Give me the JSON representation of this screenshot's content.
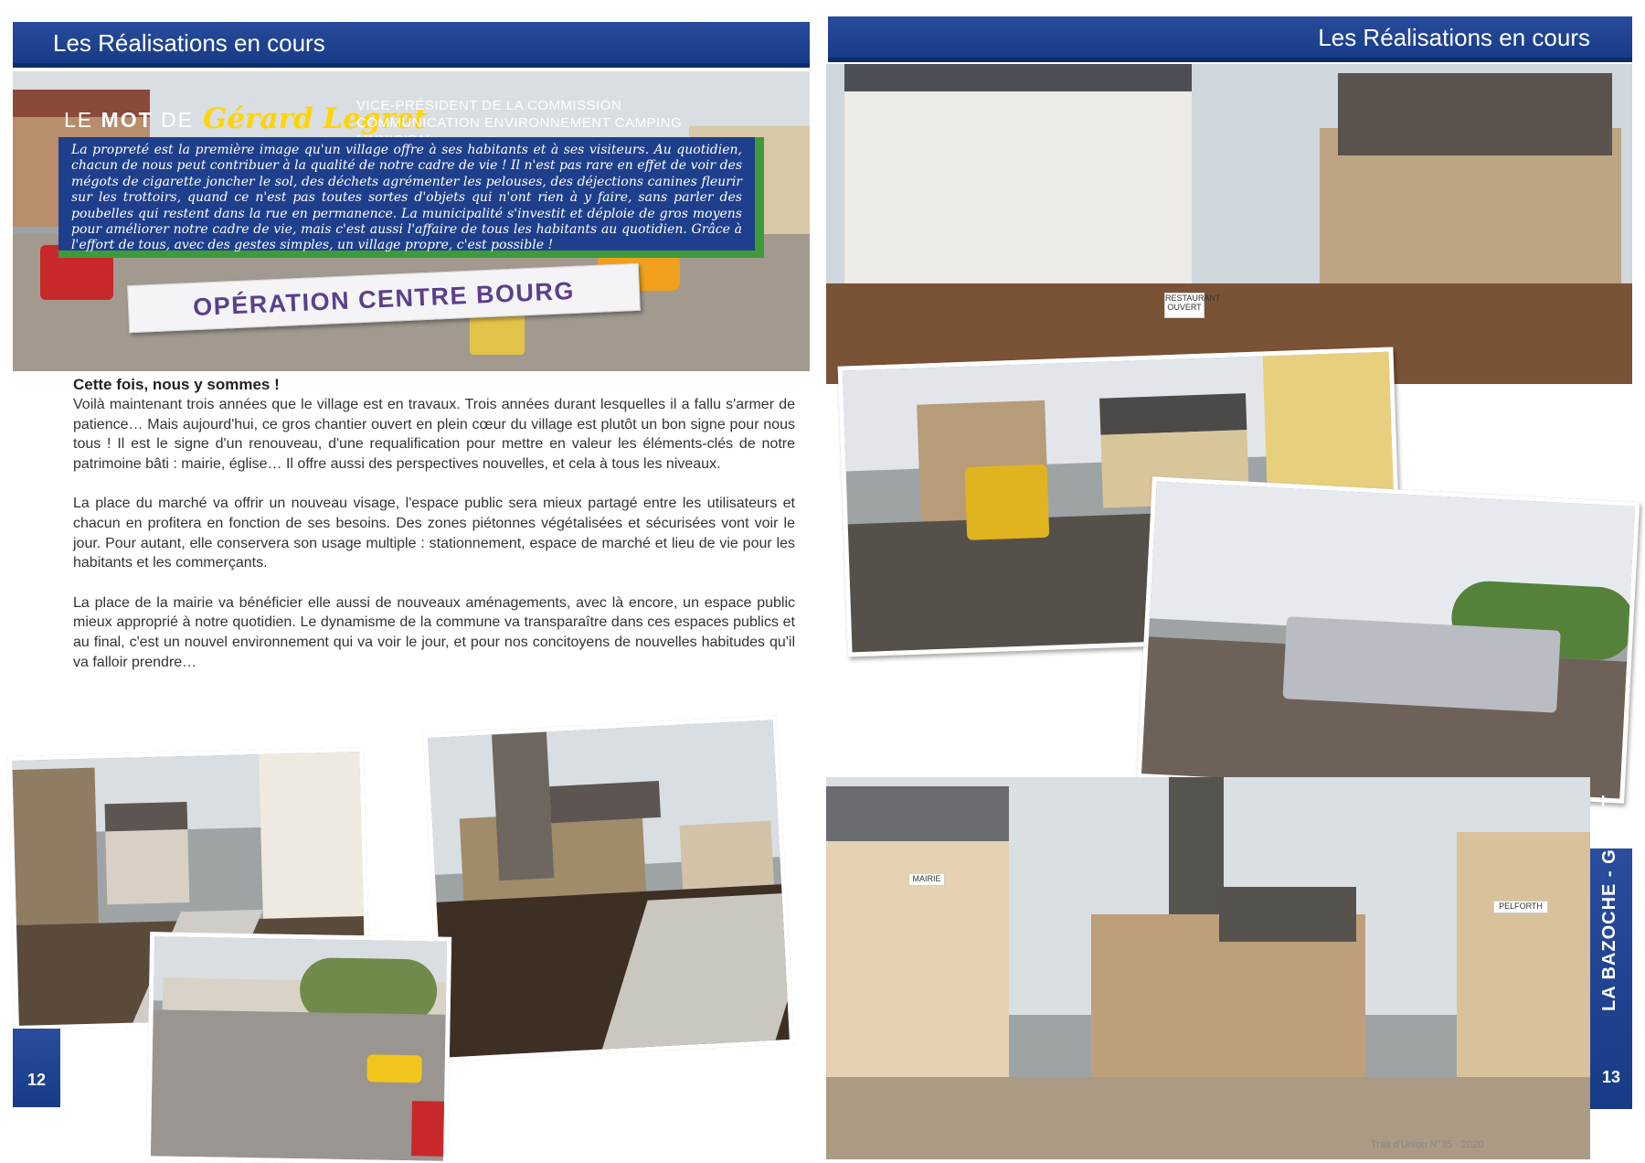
{
  "left_page": {
    "header": "Les Réalisations en cours",
    "mot": {
      "lead": "LE",
      "lead_bold": "MOT",
      "lead_end": "DE",
      "name": "Gérard Legret",
      "role": "VICE-PRÉSIDENT DE LA COMMISSION COMMUNICATION ENVIRONNEMENT CAMPING MUNICIPAL",
      "quote": "La propreté est la première image qu'un village offre à ses habitants et à ses visiteurs. Au quotidien, chacun de nous peut contribuer à la qualité de notre cadre de vie ! Il n'est pas rare en effet de voir des mégots de cigarette joncher le sol, des déchets agrémenter les pelouses, des déjections canines fleurir sur les trottoirs, quand ce n'est pas toutes sortes d'objets qui n'ont rien à y faire, sans parler des poubelles qui restent dans la rue en permanence. La municipalité s'investit et déploie de gros moyens pour améliorer notre cadre de vie, mais c'est aussi l'affaire de tous les habitants au quotidien. Grâce à l'effort de tous, avec des gestes simples, un village propre, c'est possible !"
    },
    "section_title": "OPÉRATION CENTRE BOURG",
    "article": {
      "heading": "Cette fois, nous y sommes !",
      "p1": "Voilà maintenant trois années que le village est en travaux. Trois années durant lesquelles il a fallu s'armer de patience… Mais aujourd'hui,  ce gros chantier ouvert en plein  cœur du village est plutôt un bon signe pour nous tous ! Il est le signe d'un renouveau, d'une requalification pour mettre en valeur les éléments-clés de notre  patrimoine bâti : mairie, église…  Il offre aussi des perspectives nouvelles, et cela à tous les niveaux.",
      "p2": "La place du marché va offrir un nouveau visage, l'espace public sera mieux partagé entre les utilisateurs et chacun en profitera en fonction de ses besoins. Des zones piétonnes végétalisées et sécurisées vont voir le jour. Pour autant, elle conservera son usage multiple : stationnement, espace de marché et lieu de vie pour les habitants et les commerçants.",
      "p3": "La place de la mairie va bénéficier elle aussi de nouveaux aménagements, avec là encore, un espace public mieux approprié à notre quotidien. Le dynamisme de la commune va  transparaître dans ces espaces publics et au final, c'est un nouvel environnement qui va voir le jour, et pour nos concitoyens de nouvelles habitudes qu'il va falloir prendre…"
    },
    "page_number": "12"
  },
  "right_page": {
    "header": "Les Réalisations en cours",
    "side_tab": "LA BAZOCHE - GOUET",
    "page_number": "13",
    "footer": "Trait d'Union N°35 - 2020",
    "signs": {
      "mairie": "MAIRIE",
      "restaurant": "RESTAURANT OUVERT",
      "pelforth": "PELFORTH"
    }
  },
  "colors": {
    "header_blue": "#1e4190",
    "accent_green": "#3f9a3a",
    "name_yellow": "#ffd400",
    "ribbon_purple": "#5b3f8a"
  }
}
